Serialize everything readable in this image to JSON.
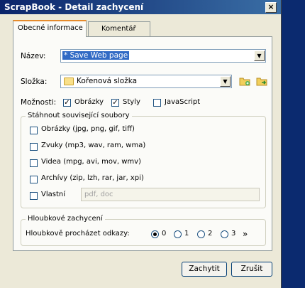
{
  "window": {
    "title": "ScrapBook - Detail zachycení",
    "close_glyph": "×"
  },
  "tabs": [
    {
      "label": "Obecné informace",
      "active": true
    },
    {
      "label": "Komentář",
      "active": false
    }
  ],
  "form": {
    "name_label": "Název:",
    "name_value": "* Save Web page",
    "folder_label": "Složka:",
    "folder_value": "Kořenová složka",
    "options_label": "Možnosti:",
    "options": [
      {
        "label": "Obrázky",
        "checked": true
      },
      {
        "label": "Styly",
        "checked": true
      },
      {
        "label": "JavaScript",
        "checked": false
      }
    ]
  },
  "download_group": {
    "title": "Stáhnout související soubory",
    "items": [
      {
        "label": "Obrázky (jpg, png, gif, tiff)",
        "checked": false
      },
      {
        "label": "Zvuky (mp3, wav, ram, wma)",
        "checked": false
      },
      {
        "label": "Videa (mpg, avi, mov, wmv)",
        "checked": false
      },
      {
        "label": "Archívy (zip, lzh, rar, jar, xpi)",
        "checked": false
      },
      {
        "label": "Vlastní",
        "checked": false
      }
    ],
    "custom_placeholder": "pdf, doc"
  },
  "depth_group": {
    "title": "Hloubkové zachycení",
    "label": "Hloubkově procházet odkazy:",
    "options": [
      "0",
      "1",
      "2",
      "3"
    ],
    "selected": "0",
    "more": "»"
  },
  "buttons": {
    "capture": "Zachytit",
    "cancel": "Zrušit"
  },
  "icons": {
    "new_folder": "folder-new-icon",
    "go": "folder-go-icon",
    "folder": "folder-icon"
  }
}
